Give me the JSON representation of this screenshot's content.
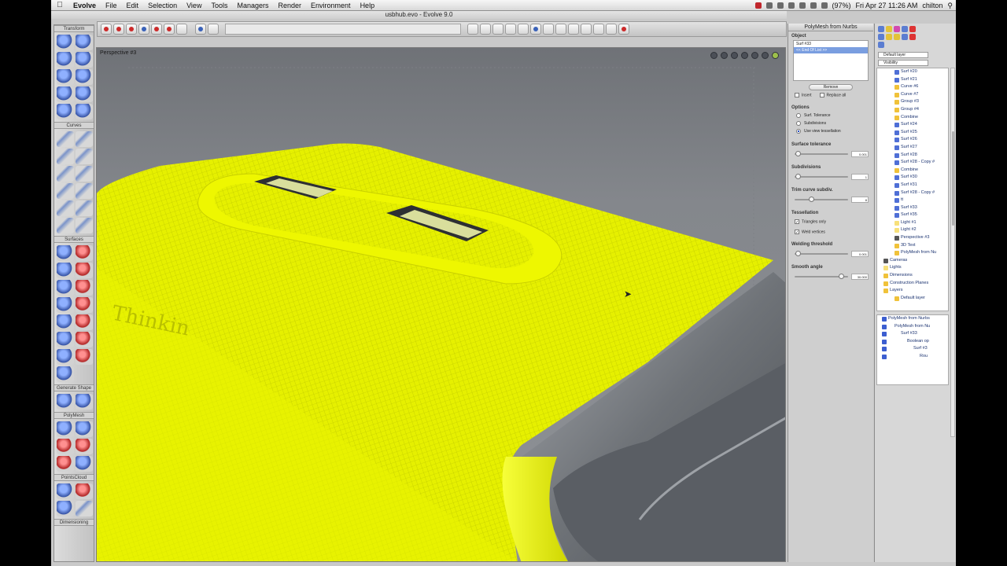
{
  "menubar": {
    "app_name": "Evolve",
    "items": [
      "File",
      "Edit",
      "Selection",
      "View",
      "Tools",
      "Managers",
      "Render",
      "Environment",
      "Help"
    ],
    "battery": "(97%)",
    "clock": "Fri Apr 27  11:26 AM",
    "user": "chilton"
  },
  "window": {
    "title": "usbhub.evo - Evolve 9.0"
  },
  "palette": {
    "groups": [
      "Transform",
      "Curves",
      "Surfaces",
      "Generate Shape",
      "PolyMesh",
      "PointsCloud",
      "Dimensioning"
    ]
  },
  "viewport": {
    "label": "Perspective #3",
    "model_text": "Thinkin"
  },
  "properties": {
    "title": "PolyMesh from Nurbs",
    "object_label": "Object",
    "object_items": [
      "Surf #33",
      "<< End Of List >>"
    ],
    "remove_label": "Remove",
    "insert_label": "Insert",
    "replace_all_label": "Replace all",
    "options_label": "Options",
    "radio_options": [
      "Surf. Tolerance",
      "Subdivisions",
      "Use view tessellation"
    ],
    "surface_tolerance_label": "Surface tolerance",
    "surface_tolerance_value": "0.001",
    "subdivisions_label": "Subdivisions",
    "subdivisions_value": "1",
    "trim_curve_label": "Trim curve subdiv.",
    "trim_curve_value": "8",
    "tessellation_label": "Tessellation",
    "triangles_only_label": "Triangles only",
    "weld_vertices_label": "Weld vertices",
    "welding_threshold_label": "Welding threshold",
    "welding_threshold_value": "0.001",
    "smooth_angle_label": "Smooth angle",
    "smooth_angle_value": "30.000"
  },
  "tree": {
    "layer_select": "Default layer",
    "filter_select": "Visibility",
    "nodes": [
      "Surf #20",
      "Surf #21",
      "Curve #6",
      "Curve #7",
      "Group #3",
      "Group #4",
      "Combine",
      "Surf #24",
      "Surf #25",
      "Surf #26",
      "Surf #27",
      "Surf #28",
      "Surf #28 - Copy #",
      "Combine",
      "Surf #30",
      "Surf #31",
      "Surf #28 - Copy #",
      "tt",
      "Surf #33",
      "Surf #35",
      "Light #1",
      "Light #2",
      "Perspective #3",
      "3D Text",
      "PolyMesh from Nu",
      "Cameras",
      "Lights",
      "Dimensions",
      "Construction Planes",
      "Layers",
      "Default layer"
    ],
    "sub_nodes": [
      "PolyMesh from Nurbs",
      "PolyMesh from Nu",
      "Surf #33",
      "Boolean op",
      "Surf #3",
      "Rou"
    ]
  }
}
